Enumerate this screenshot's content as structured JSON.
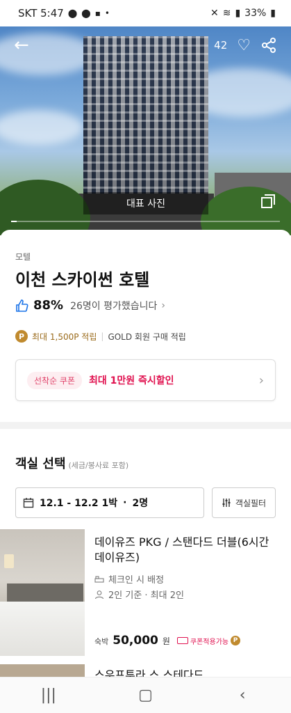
{
  "status_bar": {
    "carrier_time": "SKT 5:47",
    "battery": "33%"
  },
  "hero": {
    "like_count": "42",
    "photo_label": "대표 사진",
    "gallery_progress": 0.02
  },
  "hotel": {
    "category": "모텔",
    "name": "이천 스카이썬 호텔",
    "rating_percent": "88%",
    "rating_text": "26명이 평가했습니다",
    "points_text": "최대 1,500P 적립",
    "gold_text": "GOLD 회원 구매 적립",
    "p_badge": "P"
  },
  "coupon": {
    "tag": "선착순 쿠폰",
    "text": "최대 1만원 즉시할인"
  },
  "room_section": {
    "title": "객실 선택",
    "subtitle": "(세금/봉사료 포함)",
    "date_range": "12.1 - 12.2 1박",
    "separator": "·",
    "guests": "2명",
    "filter_label": "객실필터"
  },
  "rooms": [
    {
      "name": "데이유즈 PKG / 스탠다드 더블(6시간 데이유즈)",
      "checkin_info": "체크인 시 배정",
      "capacity": "2인 기준 · 최대 2인",
      "price_label": "숙박",
      "price": "50,000",
      "price_unit": "원",
      "coupon_label": "쿠폰적용가능"
    }
  ],
  "next_room_partial": "스우프투라 스 스테다드"
}
